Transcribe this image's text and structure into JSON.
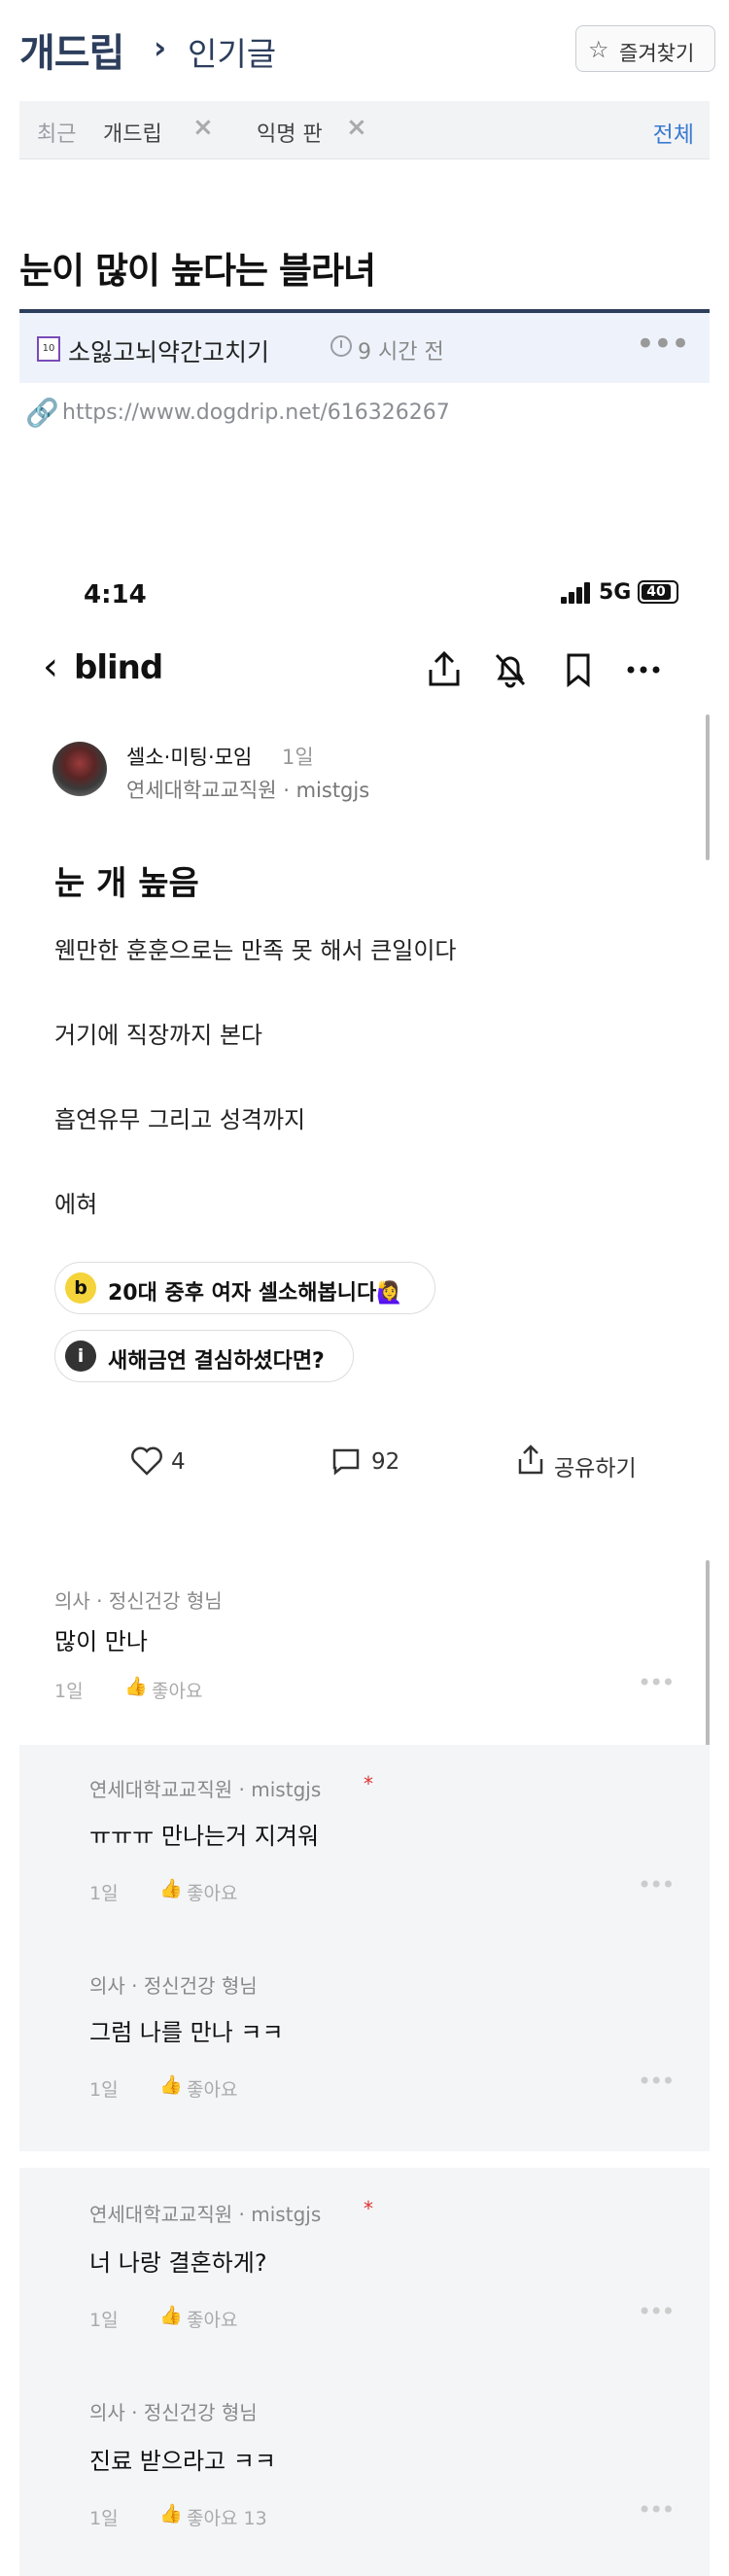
{
  "site": {
    "brand": "개드립",
    "chevron": "›",
    "board": "인기글",
    "favorite_label": "즐겨찾기",
    "recent_title": "최근",
    "recent_items": [
      "개드립",
      "익명 판"
    ],
    "all_link": "전체"
  },
  "post": {
    "title": "눈이 많이 높다는 블라녀",
    "author_badge": "10",
    "author": "소잃고뇌약간고치기",
    "time": "9 시간 전",
    "url": "https://www.dogdrip.net/616326267"
  },
  "phone": {
    "status_time": "4:14",
    "network": "5G",
    "battery": "40",
    "app_name": "blind",
    "writer": {
      "name": "셀소·미팅·모임",
      "age": "1일",
      "org": "연세대학교교직원 · mistgjs"
    },
    "title": "눈 개 높음",
    "lines": [
      "웬만한 훈훈으로는 만족 못 해서 큰일이다",
      "거기에 직장까지 본다",
      "흡연유무 그리고 성격까지",
      "에혀"
    ],
    "pills": [
      {
        "icon": "b",
        "text": "20대 중후 여자 셀소해봅니다🙋‍♀️"
      },
      {
        "icon": "i",
        "text": "새해금연 결심하셨다면?"
      }
    ],
    "actions": {
      "likes": "4",
      "comments": "92",
      "share": "공유하기"
    },
    "comments": [
      {
        "meta": "의사 · 정신건강 형님",
        "text": "많이 만나",
        "age": "1일",
        "like": "좋아요"
      },
      {
        "meta": "연세대학교교직원 · mistgjs",
        "star": "*",
        "text": "ㅠㅠㅠ 만나는거 지겨워",
        "age": "1일",
        "like": "좋아요"
      },
      {
        "meta": "의사 · 정신건강 형님",
        "text": "그럼 나를 만나 ㅋㅋ",
        "age": "1일",
        "like": "좋아요"
      },
      {
        "meta": "연세대학교교직원 · mistgjs",
        "star": "*",
        "text": "너 나랑 결혼하게?",
        "age": "1일",
        "like": "좋아요"
      },
      {
        "meta": "의사 · 정신건강 형님",
        "text": "진료 받으라고 ㅋㅋ",
        "age": "1일",
        "like": "좋아요 13"
      }
    ]
  }
}
